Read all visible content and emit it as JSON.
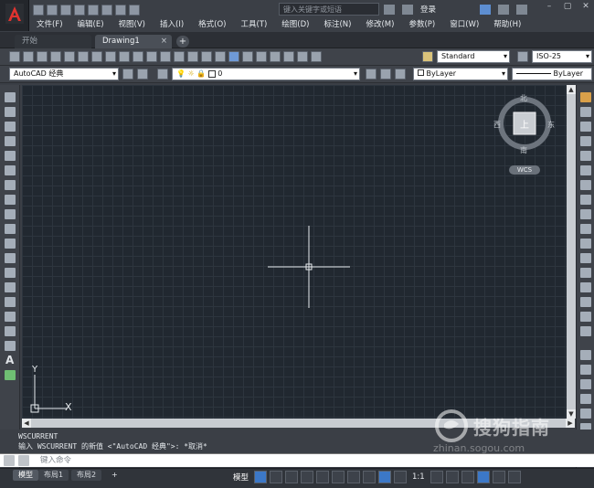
{
  "app": {
    "logo_icon": "autocad-logo-icon",
    "search_placeholder": "键入关键字或短语",
    "login_label": "登录"
  },
  "menu": [
    "文件(F)",
    "编辑(E)",
    "视图(V)",
    "插入(I)",
    "格式(O)",
    "工具(T)",
    "绘图(D)",
    "标注(N)",
    "修改(M)",
    "参数(P)",
    "窗口(W)",
    "帮助(H)"
  ],
  "tabs": {
    "start": "开始",
    "drawing": "Drawing1",
    "close": "×",
    "add": "+"
  },
  "toolbar": {
    "text_style": "Standard",
    "dim_style": "ISO-25",
    "workspace": "AutoCAD 经典",
    "layer_value": "0",
    "color_value": "ByLayer",
    "linetype_value": "ByLayer"
  },
  "viewcube": {
    "north": "北",
    "south": "南",
    "east": "东",
    "west": "西",
    "face": "上",
    "wcs": "WCS"
  },
  "ucs": {
    "y_label": "Y",
    "x_label": "X"
  },
  "command": {
    "history_1": "WSCURRENT",
    "history_2": "输入 WSCURRENT 的新值 <\"AutoCAD 经典\">: *取消*",
    "placeholder": "键入命令"
  },
  "status": {
    "model_tab": "模型",
    "layout1": "布局1",
    "layout2": "布局2",
    "add": "+",
    "model_label": "模型",
    "scale": "1:1"
  },
  "watermark": {
    "text": "搜狗指南",
    "url": "zhinan.sogou.com"
  },
  "colors": {
    "canvas_bg": "#212830",
    "grid": "#2d353e",
    "accent_blue": "#3c78c7"
  }
}
